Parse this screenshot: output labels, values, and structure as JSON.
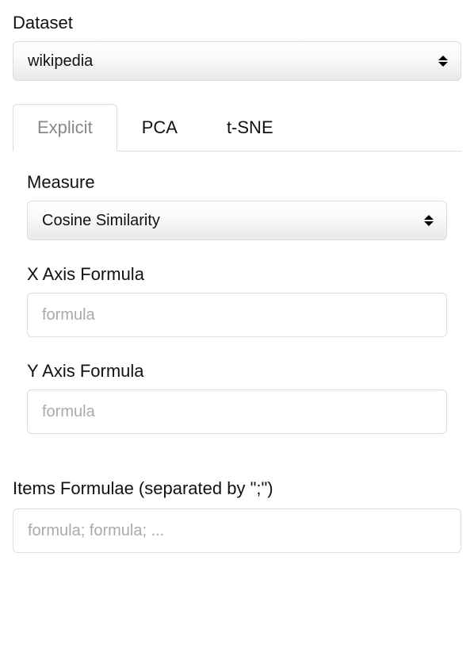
{
  "dataset": {
    "label": "Dataset",
    "selected": "wikipedia"
  },
  "tabs": {
    "explicit": "Explicit",
    "pca": "PCA",
    "tsne": "t-SNE"
  },
  "measure": {
    "label": "Measure",
    "selected": "Cosine Similarity"
  },
  "xaxis": {
    "label": "X Axis Formula",
    "placeholder": "formula",
    "value": ""
  },
  "yaxis": {
    "label": "Y Axis Formula",
    "placeholder": "formula",
    "value": ""
  },
  "items": {
    "label": "Items Formulae (separated by \";\")",
    "placeholder": "formula; formula; ...",
    "value": ""
  }
}
